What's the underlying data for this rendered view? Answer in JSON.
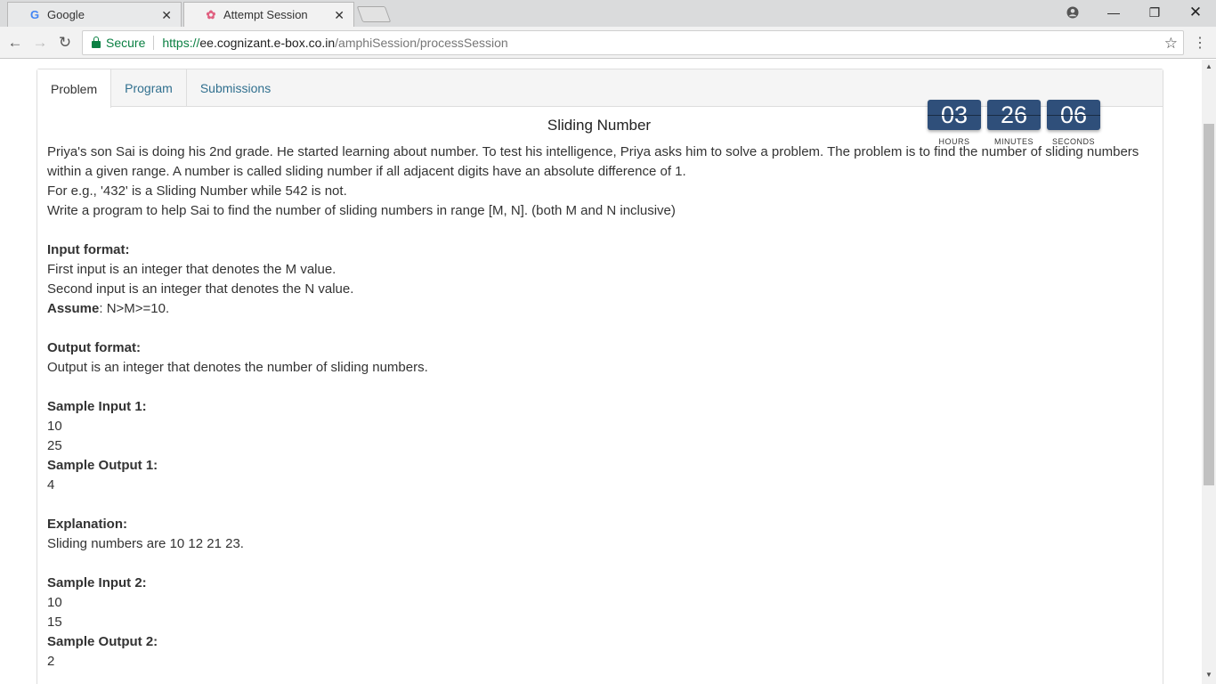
{
  "browser": {
    "tabs": [
      {
        "title": "Google",
        "icon": "google-icon"
      },
      {
        "title": "Attempt Session",
        "icon": "ebox-icon"
      }
    ],
    "address": {
      "secure_label": "Secure",
      "scheme": "https://",
      "host": "ee.cognizant.e-box.co.in",
      "path": "/amphiSession/processSession"
    }
  },
  "panel": {
    "tabs": [
      "Problem",
      "Program",
      "Submissions"
    ],
    "active_tab": "Problem"
  },
  "timer": {
    "hours": "03",
    "minutes": "26",
    "seconds": "06",
    "hours_label": "HOURS",
    "minutes_label": "MINUTES",
    "seconds_label": "SECONDS"
  },
  "problem": {
    "title": "Sliding Number",
    "intro1": "Priya's son Sai is doing his 2nd grade. He started learning about number. To test his intelligence, Priya asks him to solve a problem. The problem is to find the number of sliding numbers within a given range. A number is called sliding number if all adjacent digits have an absolute difference of 1.",
    "intro2": "For e.g.,  '432' is a Sliding Number while 542 is not.",
    "intro3": "Write a program to help Sai to find the number of sliding numbers in range [M, N]. (both M and N inclusive)",
    "input_heading": "Input format:",
    "input_line1": "First input is an integer that denotes the M value.",
    "input_line2": "Second input is an integer that denotes the N value.",
    "assume_label": "Assume",
    "assume_text": ": N>M>=10.",
    "output_heading": "Output format:",
    "output_line": "Output is an integer that denotes the number of sliding numbers.",
    "sample_input1_heading": "Sample Input 1:",
    "sample_input1": [
      "10",
      "25"
    ],
    "sample_output1_heading": "Sample Output 1:",
    "sample_output1": "4",
    "explanation_heading": "Explanation:",
    "explanation": "Sliding numbers are 10 12 21 23.",
    "sample_input2_heading": "Sample Input 2:",
    "sample_input2": [
      "10",
      "15"
    ],
    "sample_output2_heading": "Sample Output 2:",
    "sample_output2": "2"
  }
}
